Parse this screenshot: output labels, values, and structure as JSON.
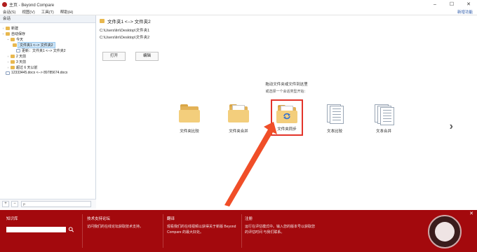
{
  "window": {
    "title": "主页 - Beyond Compare"
  },
  "menubar": {
    "items": [
      "会话(S)",
      "视图(V)",
      "工具(T)",
      "帮助(H)"
    ],
    "right_link": "新增功能"
  },
  "sessions": {
    "header": "会话",
    "tree": [
      {
        "label": "新建",
        "indent": 0
      },
      {
        "label": "自动保存",
        "indent": 0
      },
      {
        "label": "今天",
        "indent": 1
      },
      {
        "label": "文件夹1 <--> 文件夹2",
        "indent": 2,
        "selected": true
      },
      {
        "label": "更新：文件夹1 <--> 文件夹2",
        "indent": 2
      },
      {
        "label": "2 天前",
        "indent": 1
      },
      {
        "label": "3 天前",
        "indent": 1
      },
      {
        "label": "超过 6 天以前",
        "indent": 1
      },
      {
        "label": "12333445.docx <--> 89785674.docx",
        "indent": 0
      }
    ],
    "bottom": {
      "add": "+",
      "remove": "−",
      "filter_placeholder": "ρ"
    }
  },
  "detail": {
    "title": "文件夹1 <--> 文件夹2",
    "paths": [
      "C:\\Users\\lin\\Desktop\\文件夹1",
      "C:\\Users\\lin\\Desktop\\文件夹2"
    ],
    "open_button": "打开",
    "edit_button": "编辑",
    "hint_primary": "拖动文件夹或文件到这里",
    "hint_secondary": "或选择一个会话类型开始："
  },
  "tiles": [
    {
      "label": "文件夹比较",
      "kind": "folder"
    },
    {
      "label": "文件夹合并",
      "kind": "folder"
    },
    {
      "label": "文件夹同步",
      "kind": "folder-sync",
      "highlighted": true
    },
    {
      "label": "文本比较",
      "kind": "doc"
    },
    {
      "label": "文本合并",
      "kind": "doc2"
    }
  ],
  "footer": {
    "kb_title": "知识库",
    "support_title": "技术支持论坛",
    "support_text": "访问我们的在线论坛获取技术支持。",
    "about_title": "翻译",
    "about_text": "观看我们的在线视频以获得关于新版 Beyond Compare 的最大好处。",
    "notice_title": "注册",
    "notice_text": "运行在评估模式中。输入您的版本号以获取您的评估时间 与我们联系。"
  },
  "colors": {
    "footer_bg": "#a3090d",
    "highlight": "#e3342a",
    "arrow": "#f04e28"
  }
}
